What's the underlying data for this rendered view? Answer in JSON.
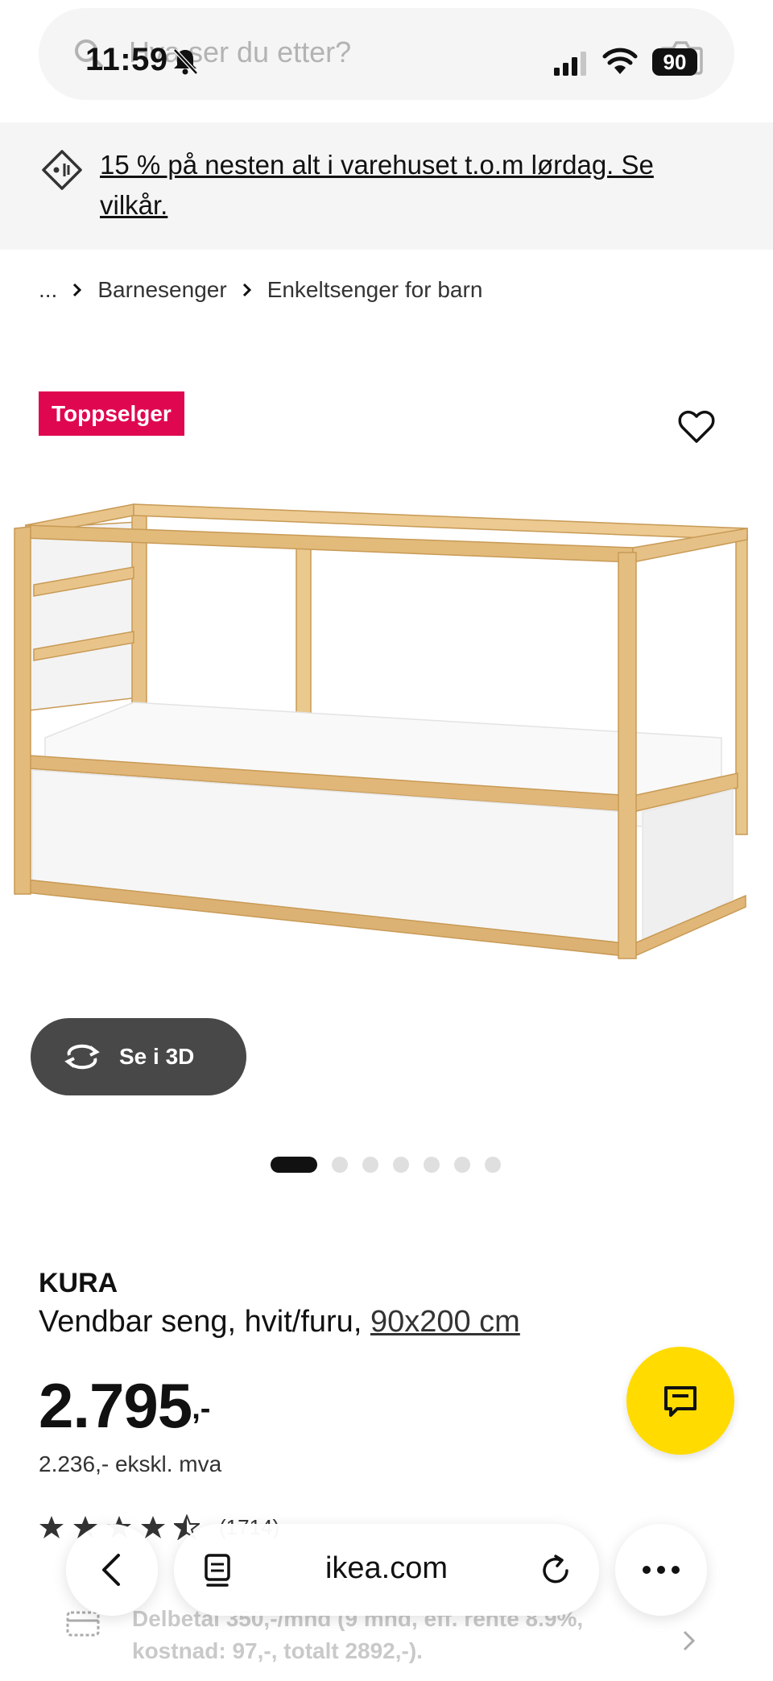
{
  "status_bar": {
    "time": "11:59",
    "battery": "90"
  },
  "search": {
    "placeholder": "Hva ser du etter?"
  },
  "promo": {
    "text": "15 % på nesten alt i varehuset t.o.m lørdag. Se vilkår."
  },
  "breadcrumb": {
    "ellipsis": "...",
    "items": [
      "Barnesenger",
      "Enkeltsenger for barn"
    ]
  },
  "product": {
    "badge": "Toppselger",
    "view_3d_label": "Se i 3D",
    "image_count": 7,
    "active_image_index": 0,
    "name": "KURA",
    "description": "Vendbar seng, hvit/furu,",
    "size": "90x200 cm",
    "price": "2.795",
    "price_suffix": ",-",
    "price_ex_vat": "2.236,- ekskl. mva",
    "rating_stars": 4.5,
    "rating_count": "(1714)"
  },
  "finance": {
    "text": "Delbetal 350,-/mnd (9 mnd, eff. rente 8.9%, kostnad: 97,-, totalt 2892,-)."
  },
  "browser": {
    "domain": "ikea.com"
  },
  "colors": {
    "badge": "#e00751",
    "chat_button": "#ffdb00",
    "button_3d": "#484848",
    "promo_bg": "#f5f5f5"
  },
  "icons": {
    "search": "search-icon",
    "bell_muted": "bell-slash-icon",
    "signal": "cellular-signal-icon",
    "wifi": "wifi-icon",
    "camera": "camera-icon",
    "promo": "price-tag-icon",
    "heart": "heart-icon",
    "rotate_3d": "rotate-3d-icon",
    "chat": "chat-icon",
    "back": "chevron-left-icon",
    "page": "page-icon",
    "reload": "reload-icon",
    "more": "more-icon",
    "finance": "card-icon"
  }
}
